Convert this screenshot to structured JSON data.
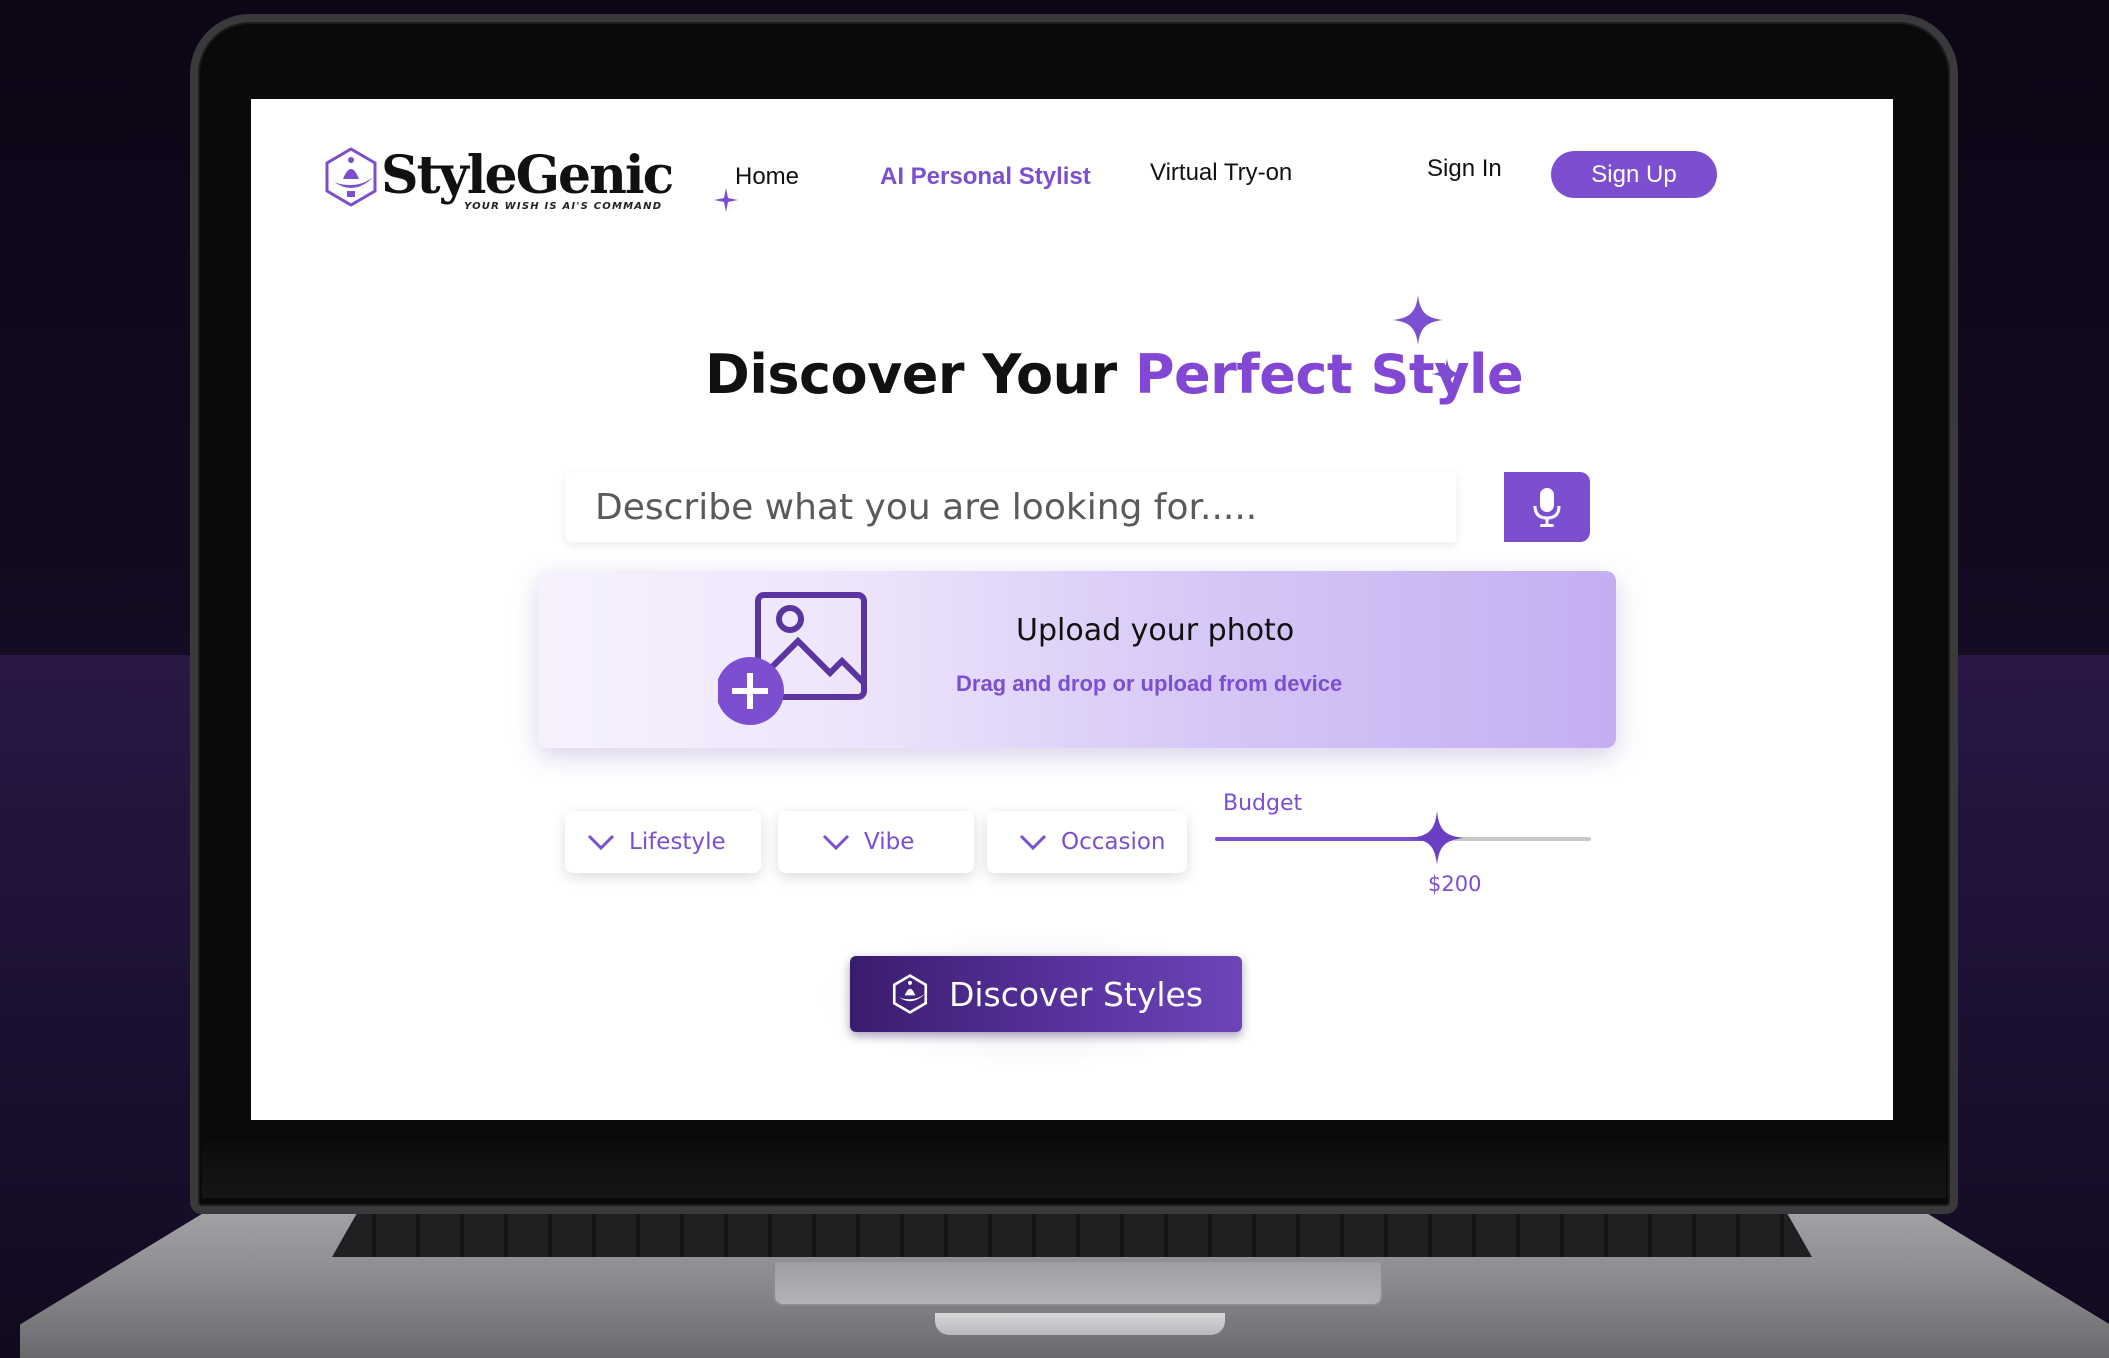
{
  "brand": {
    "name": "StyleGenic",
    "tagline": "YOUR WISH IS AI'S COMMAND"
  },
  "nav": {
    "home": "Home",
    "stylist": "AI Personal Stylist",
    "tryon": "Virtual Try-on",
    "signin": "Sign In",
    "signup": "Sign Up"
  },
  "hero": {
    "title_plain": "Discover Your ",
    "title_accent": "Perfect Style"
  },
  "search": {
    "placeholder": "Describe what you are looking for....."
  },
  "upload": {
    "title": "Upload your photo",
    "subtitle": "Drag and drop or upload from device"
  },
  "filters": {
    "lifestyle": "Lifestyle",
    "vibe": "Vibe",
    "occasion": "Occasion"
  },
  "budget": {
    "label": "Budget",
    "value": "$200",
    "fraction": 0.59
  },
  "cta": {
    "label": "Discover Styles"
  },
  "colors": {
    "accent": "#7c4fd0",
    "accent_text": "#7b4fcf",
    "cta_dark": "#3a1c6e",
    "background": "#0d0714"
  },
  "icons": [
    "lamp-logo-icon",
    "sparkle-icon",
    "microphone-icon",
    "image-upload-icon",
    "chevron-down-icon",
    "slider-star-thumb-icon"
  ]
}
